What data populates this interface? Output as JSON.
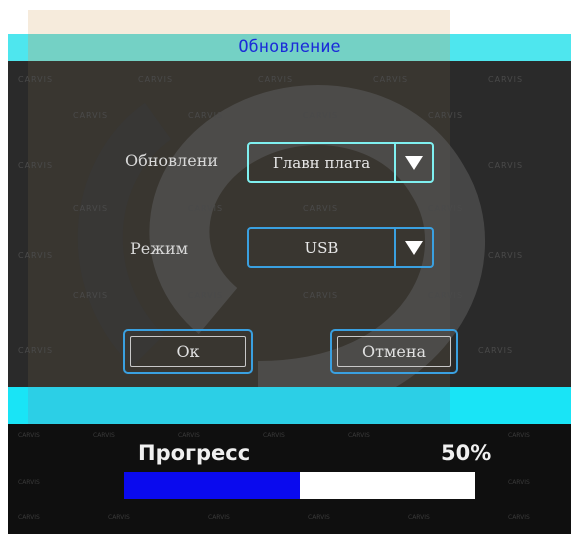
{
  "dialog": {
    "title": "Обновление",
    "update_label": "Обновлени",
    "update_value": "Главн плата",
    "mode_label": "Режим",
    "mode_value": "USB",
    "ok_label": "Ок",
    "cancel_label": "Отмена",
    "watermark": "CARVIS"
  },
  "progress": {
    "label": "Прогресс",
    "percent_text": "50%",
    "fraction": 0.5
  },
  "colors": {
    "title_bar": "#4ee6ee",
    "title_text": "#1b2bd8",
    "field_border": "#3aa0e0",
    "focused_border": "#7ff0f0",
    "progress_fill": "#0a0aee",
    "cyan_band": "#19e4f6"
  }
}
